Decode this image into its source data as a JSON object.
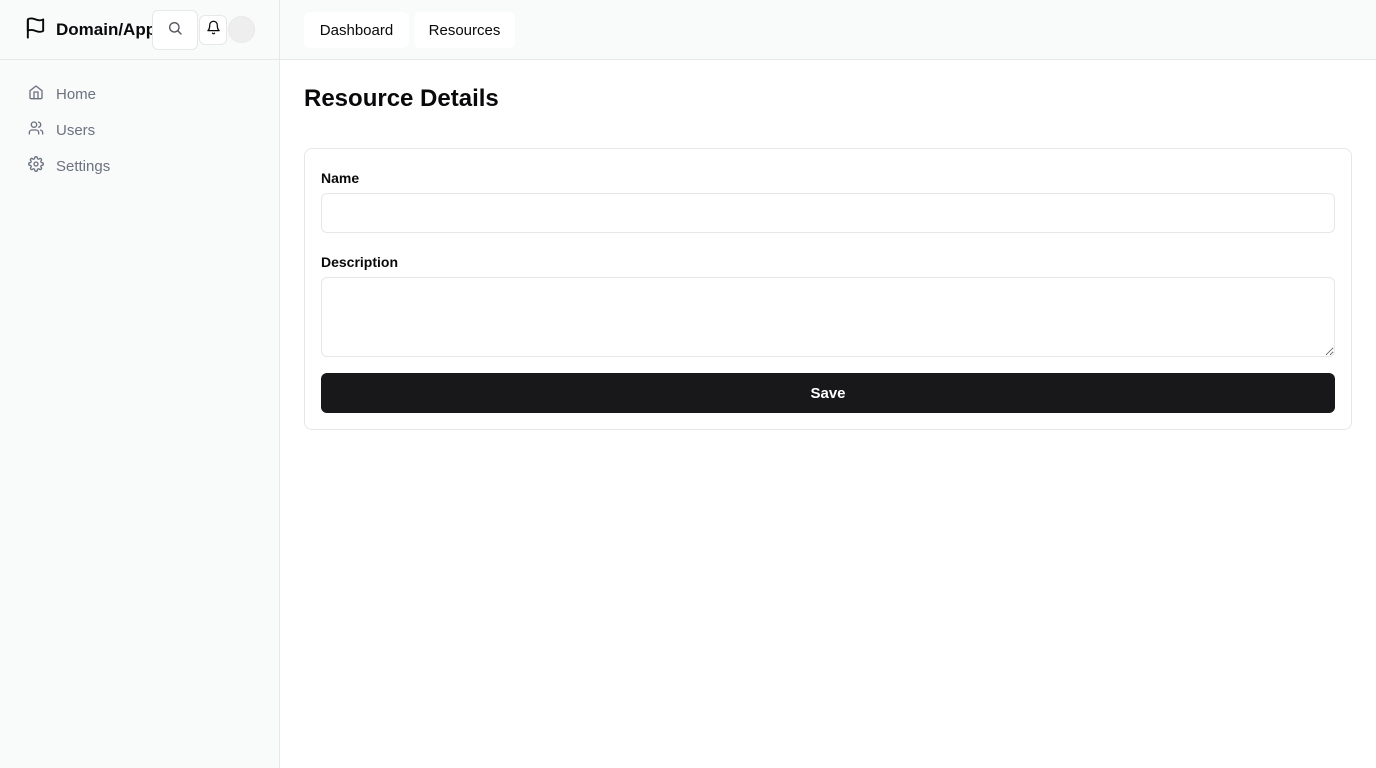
{
  "app": {
    "name": "Domain/App"
  },
  "header": {
    "search_icon": "search-icon",
    "bell_icon": "bell-icon",
    "tabs": [
      {
        "label": "Dashboard"
      },
      {
        "label": "Resources"
      }
    ]
  },
  "sidebar": {
    "items": [
      {
        "label": "Home",
        "icon": "home-icon"
      },
      {
        "label": "Users",
        "icon": "users-icon"
      },
      {
        "label": "Settings",
        "icon": "gear-icon"
      }
    ]
  },
  "main": {
    "title": "Resource Details",
    "form": {
      "name_label": "Name",
      "name_value": "",
      "description_label": "Description",
      "description_value": "",
      "save_label": "Save"
    }
  },
  "colors": {
    "primary": "#18181b",
    "sidebar_bg": "#f9fafa",
    "border": "#e5e7eb",
    "muted_text": "#6b7280"
  }
}
